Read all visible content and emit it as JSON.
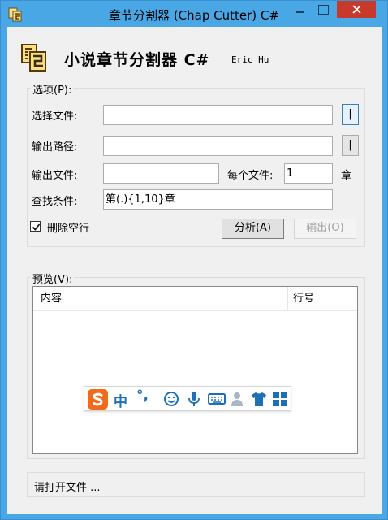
{
  "window": {
    "title": "章节分割器 (Chap Cutter) C#"
  },
  "header": {
    "title": "小说章节分割器 C#",
    "author": "Eric Hu"
  },
  "options": {
    "legend": "选项(P):",
    "select_file_label": "选择文件:",
    "select_file_value": "",
    "select_file_button": "|",
    "output_path_label": "输出路径:",
    "output_path_value": "",
    "output_path_button": "|",
    "output_file_label": "输出文件:",
    "output_file_value": "",
    "per_file_label": "每个文件:",
    "per_file_value": "1",
    "per_file_unit": "章",
    "find_cond_label": "查找条件:",
    "find_cond_value": "第(.){1,10}章",
    "delete_blank_label": "删除空行",
    "delete_blank_checked": true,
    "analyze_button": "分析(A)",
    "export_button": "输出(O)"
  },
  "preview": {
    "legend": "预览(V):",
    "columns": [
      "内容",
      "行号",
      ""
    ]
  },
  "ime": {
    "logo": "sogou-s-logo",
    "mode": "中",
    "punct": "°,",
    "icons": [
      "smiley-icon",
      "microphone-icon",
      "keyboard-icon",
      "user-icon",
      "tshirt-icon",
      "grid-icon"
    ],
    "accent": "#1f6fb5",
    "logo_color": "#f26b1d"
  },
  "status": {
    "text": "请打开文件 ..."
  },
  "colors": {
    "titlebar": "#4aa7e6",
    "close": "#c7392b",
    "client": "#f0f0f0"
  }
}
